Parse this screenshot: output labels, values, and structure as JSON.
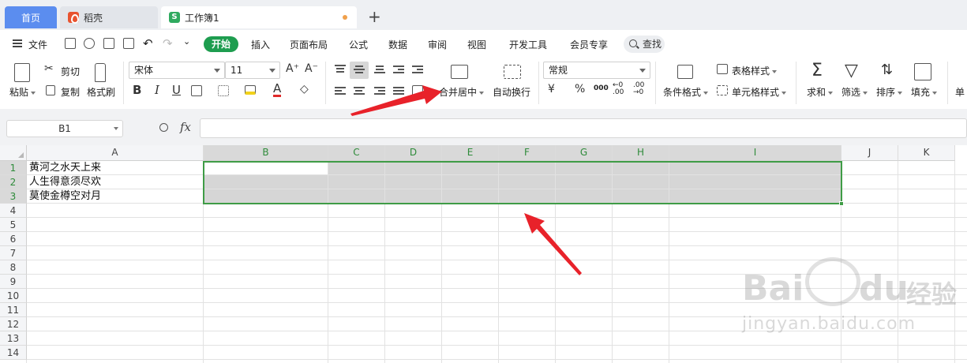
{
  "tabs": {
    "home": "首页",
    "daoke": "稻壳",
    "workbook": "工作簿1",
    "sheet_icon_letter": "S"
  },
  "menu": {
    "file": "文件",
    "start": "开始",
    "insert": "插入",
    "layout": "页面布局",
    "formula": "公式",
    "data": "数据",
    "review": "审阅",
    "view": "视图",
    "devtools": "开发工具",
    "member": "会员专享",
    "search": "查找"
  },
  "ribbon": {
    "paste": "粘贴",
    "cut": "剪切",
    "copy": "复制",
    "format_painter": "格式刷",
    "font_name": "宋体",
    "font_size": "11",
    "bold": "B",
    "italic": "I",
    "underline": "U",
    "font_color_letter": "A",
    "merge_center": "合并居中",
    "wrap_text": "自动换行",
    "number_format": "常规",
    "currency": "¥",
    "percent": "%",
    "thousands": "000",
    "cond_format": "条件格式",
    "table_style": "表格样式",
    "cell_style": "单元格样式",
    "sum": "求和",
    "filter": "筛选",
    "sort": "排序",
    "fill": "填充",
    "cell_partial": "单"
  },
  "formula_bar": {
    "name_box": "B1",
    "fx": "fx",
    "value": ""
  },
  "grid": {
    "columns": [
      "A",
      "B",
      "C",
      "D",
      "E",
      "F",
      "G",
      "H",
      "I",
      "J",
      "K"
    ],
    "rows": [
      "1",
      "2",
      "3",
      "4",
      "5",
      "6",
      "7",
      "8",
      "9",
      "10",
      "11",
      "12",
      "13",
      "14"
    ],
    "cells_A": [
      "黄河之水天上来",
      "人生得意须尽欢",
      "莫使金樽空对月"
    ],
    "selected_columns": [
      "B",
      "C",
      "D",
      "E",
      "F",
      "G",
      "H",
      "I"
    ],
    "selected_rows": [
      "1",
      "2",
      "3"
    ]
  },
  "watermark": {
    "brand": "Bai",
    "brand2": "du",
    "cn": "经验",
    "url": "jingyan.baidu.com"
  },
  "colors": {
    "accent_green": "#1e9d4f",
    "selection_green": "#3f9c46",
    "tab_blue": "#5b8def",
    "arrow_red": "#e8222a"
  }
}
